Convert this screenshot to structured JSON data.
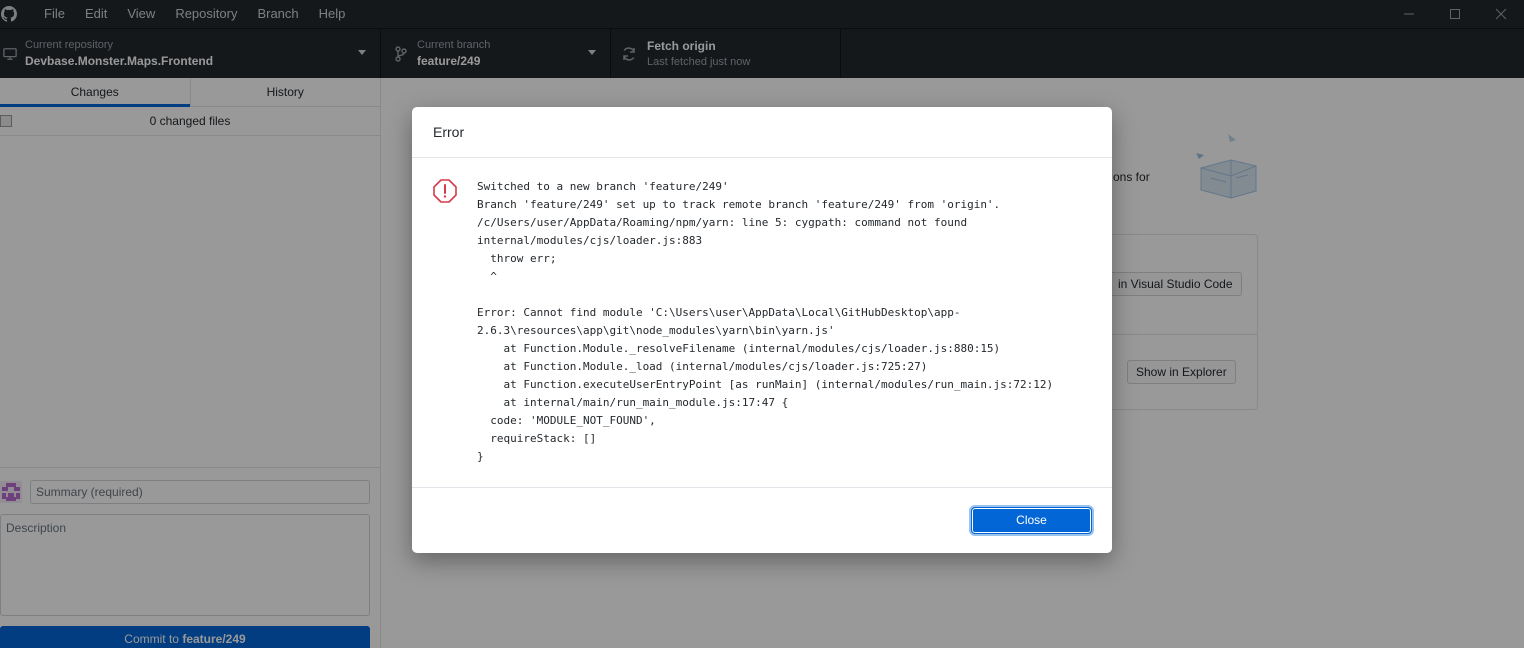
{
  "menu": {
    "items": [
      "File",
      "Edit",
      "View",
      "Repository",
      "Branch",
      "Help"
    ]
  },
  "toolbar": {
    "repository": {
      "label": "Current repository",
      "value": "Devbase.Monster.Maps.Frontend"
    },
    "branch": {
      "label": "Current branch",
      "value": "feature/249"
    },
    "fetch": {
      "label": "Fetch origin",
      "value": "Last fetched just now"
    }
  },
  "sidebar": {
    "tabs": [
      "Changes",
      "History"
    ],
    "changed_files": "0 changed files",
    "summary_placeholder": "Summary (required)",
    "description_placeholder": "Description",
    "commit_prefix": "Commit to",
    "commit_branch": "feature/249"
  },
  "main": {
    "partial_text": "ons for",
    "open_editor_label": "in Visual Studio Code",
    "show_explorer_label": "Show in Explorer"
  },
  "dialog": {
    "title": "Error",
    "message": "Switched to a new branch 'feature/249'\nBranch 'feature/249' set up to track remote branch 'feature/249' from 'origin'.\n/c/Users/user/AppData/Roaming/npm/yarn: line 5: cygpath: command not found\ninternal/modules/cjs/loader.js:883\n  throw err;\n  ^\n\nError: Cannot find module 'C:\\Users\\user\\AppData\\Local\\GitHubDesktop\\app-\n2.6.3\\resources\\app\\git\\node_modules\\yarn\\bin\\yarn.js'\n    at Function.Module._resolveFilename (internal/modules/cjs/loader.js:880:15)\n    at Function.Module._load (internal/modules/cjs/loader.js:725:27)\n    at Function.executeUserEntryPoint [as runMain] (internal/modules/run_main.js:72:12)\n    at internal/main/run_main_module.js:17:47 {\n  code: 'MODULE_NOT_FOUND',\n  requireStack: []\n}",
    "close_label": "Close"
  },
  "colors": {
    "titlebar": "#24292e",
    "accent": "#0366d6",
    "error": "#d73a49"
  },
  "icons": [
    "github-logo-icon",
    "desktop-icon",
    "branch-icon",
    "sync-icon",
    "error-icon",
    "minimize-icon",
    "maximize-icon",
    "close-window-icon"
  ]
}
